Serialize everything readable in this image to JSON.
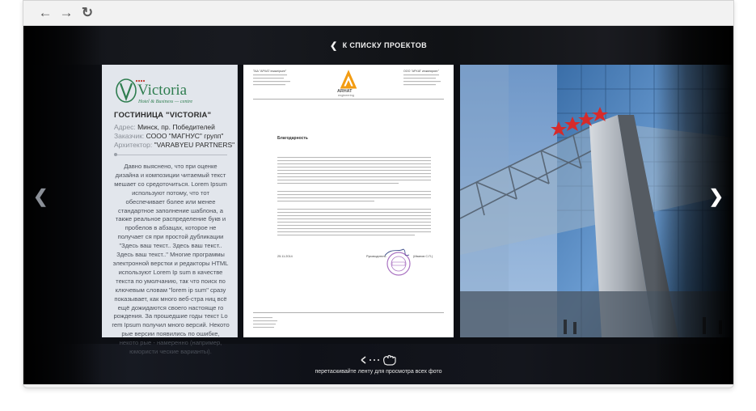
{
  "browser": {
    "buttons": {
      "back": "back-arrow-icon",
      "forward": "forward-arrow-icon",
      "reload": "reload-icon"
    }
  },
  "gallery": {
    "back_label": "К СПИСКУ ПРОЕКТОВ",
    "drag_hint": "перетаскивайте ленту для просмотра всех фото",
    "accent_color": "#2e7d4f"
  },
  "project": {
    "logo_text": "Victoria",
    "logo_sub": "Hotel & Business — centre",
    "title": "ГОСТИНИЦА \"VICTORIA\"",
    "address_label": "Адрес:",
    "address_value": "Минск, пр. Победителей",
    "client_label": "Заказчик:",
    "client_value": "СООО \"МАГНУС\" групп\"",
    "architect_label": "Архитектор:",
    "architect_value": "\"VARABYEU PARTNERS\"",
    "description": "Давно выяснено, что при оценке дизайна и композиции читаемый текст мешает со средоточиться. Lorem Ipsum используют потому, что тот обеспечивает более или менее стандартное заполнение шаблона, а также реальное распределение букв и пробелов в абзацах, которое не получает ся при простой дубликации \"Здесь ваш текст.. Здесь ваш текст.. Здесь ваш текст..\" Многие программы электронной верстки и редакторы HTML используют Lorem Ip sum в качестве текста по умолчанию, так что поиск по ключевым словам \"lorem ip sum\" сразу показывает, как много веб-стра ниц всё ещё дожидаются своего настояще го рождения. За прошедшие годы текст Lo rem Ipsum получил много версий. Некото рые версии появились по ошибке, некото рые - намеренно (например, юмористи ческие варианты)."
  },
  "document": {
    "company_left": "ТАА \"АРХАТ інжынірынг\"",
    "company_right": "ООО \"АРХАТ инжиниринг\"",
    "logo_name": "ARHAT",
    "logo_sub": "engineering",
    "heading": "Благодарность",
    "date": "25.11.2014",
    "signature_label": "Руководитель",
    "signatory": "(Иванов С.П.)"
  }
}
